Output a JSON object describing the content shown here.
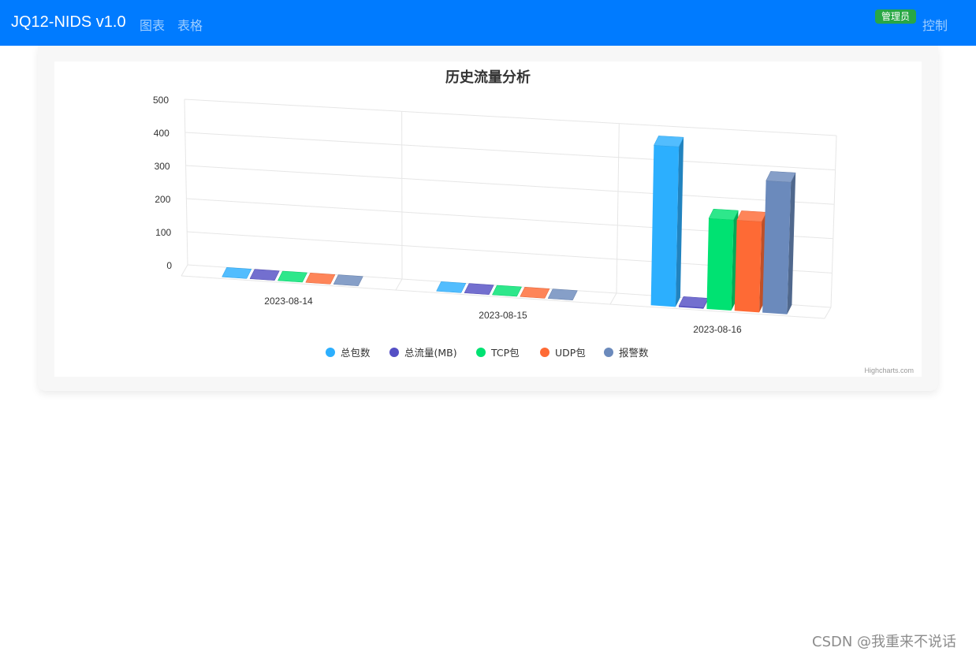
{
  "navbar": {
    "brand": "JQ12-NIDS v1.0",
    "links": [
      "图表",
      "表格"
    ],
    "badge": "管理员",
    "control": "控制",
    "color": "#007bff"
  },
  "chart_data": {
    "type": "bar",
    "title": "历史流量分析",
    "categories": [
      "2023-08-14",
      "2023-08-15",
      "2023-08-16"
    ],
    "ylim": [
      0,
      500
    ],
    "yticks": [
      "500",
      "400",
      "300",
      "200",
      "100",
      "0"
    ],
    "grid": true,
    "legend_position": "bottom",
    "series": [
      {
        "name": "总包数",
        "color": "#2caffe",
        "values": [
          0,
          0,
          470
        ]
      },
      {
        "name": "总流量(MB)",
        "color": "#544fc5",
        "values": [
          0,
          0,
          3
        ]
      },
      {
        "name": "TCP包",
        "color": "#00e272",
        "values": [
          0,
          0,
          265
        ]
      },
      {
        "name": "UDP包",
        "color": "#fe6a35",
        "values": [
          0,
          0,
          265
        ]
      },
      {
        "name": "报警数",
        "color": "#6b8abc",
        "values": [
          0,
          0,
          385
        ]
      }
    ],
    "credits": "Highcharts.com"
  },
  "watermark": "CSDN @我重来不说话"
}
